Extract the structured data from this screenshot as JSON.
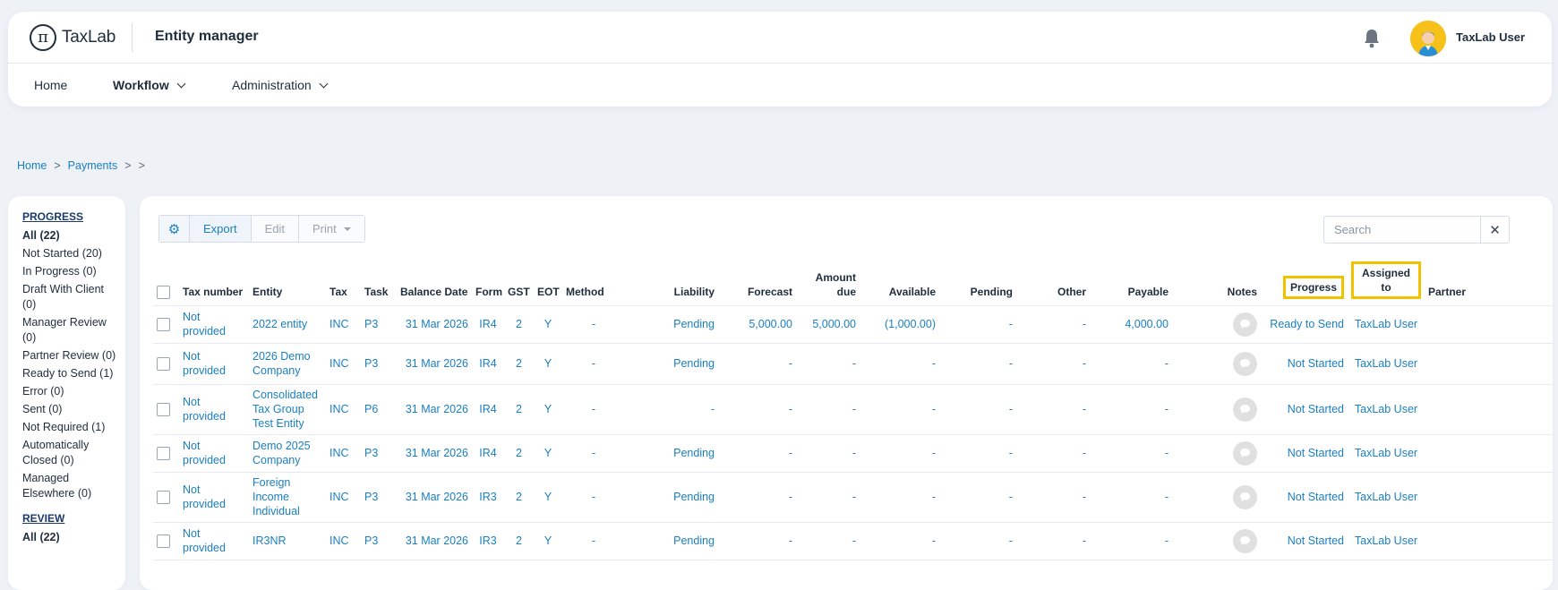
{
  "header": {
    "logo_text": "TaxLab",
    "app_title": "Entity manager",
    "user_name": "TaxLab User"
  },
  "nav": {
    "items": [
      {
        "label": "Home"
      },
      {
        "label": "Workflow"
      },
      {
        "label": "Administration"
      }
    ]
  },
  "breadcrumb": {
    "items": [
      "Home",
      "Payments"
    ],
    "separator": ">"
  },
  "sidebar": {
    "progress_heading": "PROGRESS",
    "progress_items": [
      "All (22)",
      "Not Started (20)",
      "In Progress (0)",
      "Draft With Client (0)",
      "Manager Review (0)",
      "Partner Review (0)",
      "Ready to Send (1)",
      "Error (0)",
      "Sent (0)",
      "Not Required (1)",
      "Automatically Closed (0)",
      "Managed Elsewhere (0)"
    ],
    "review_heading": "REVIEW",
    "review_items": [
      "All (22)"
    ]
  },
  "toolbar": {
    "export_label": "Export",
    "edit_label": "Edit",
    "print_label": "Print",
    "search_placeholder": "Search",
    "clear_label": "✕"
  },
  "table": {
    "headers": {
      "tax_number": "Tax number",
      "entity": "Entity",
      "tax": "Tax",
      "task": "Task",
      "balance_date": "Balance Date",
      "form": "Form",
      "gst": "GST",
      "eot": "EOT",
      "method": "Method",
      "liability": "Liability",
      "forecast": "Forecast",
      "amount_due": "Amount due",
      "available": "Available",
      "pending": "Pending",
      "other": "Other",
      "payable": "Payable",
      "notes": "Notes",
      "progress": "Progress",
      "assigned_to": "Assigned to",
      "partner": "Partner"
    },
    "rows": [
      {
        "tax_number": "Not provided",
        "entity": "2022 entity",
        "tax": "INC",
        "task": "P3",
        "balance_date": "31 Mar 2026",
        "form": "IR4",
        "gst": "2",
        "eot": "Y",
        "method": "-",
        "liability": "Pending",
        "forecast": "5,000.00",
        "amount_due": "5,000.00",
        "available": "(1,000.00)",
        "pending": "-",
        "other": "-",
        "payable": "4,000.00",
        "progress": "Ready to Send",
        "assigned_to": "TaxLab User",
        "partner": ""
      },
      {
        "tax_number": "Not provided",
        "entity": "2026 Demo Company",
        "tax": "INC",
        "task": "P3",
        "balance_date": "31 Mar 2026",
        "form": "IR4",
        "gst": "2",
        "eot": "Y",
        "method": "-",
        "liability": "Pending",
        "forecast": "-",
        "amount_due": "-",
        "available": "-",
        "pending": "-",
        "other": "-",
        "payable": "-",
        "progress": "Not Started",
        "assigned_to": "TaxLab User",
        "partner": ""
      },
      {
        "tax_number": "Not provided",
        "entity": "Consolidated Tax Group Test Entity",
        "tax": "INC",
        "task": "P6",
        "balance_date": "31 Mar 2026",
        "form": "IR4",
        "gst": "2",
        "eot": "Y",
        "method": "-",
        "liability": "-",
        "forecast": "-",
        "amount_due": "-",
        "available": "-",
        "pending": "-",
        "other": "-",
        "payable": "-",
        "progress": "Not Started",
        "assigned_to": "TaxLab User",
        "partner": ""
      },
      {
        "tax_number": "Not provided",
        "entity": "Demo 2025 Company",
        "tax": "INC",
        "task": "P3",
        "balance_date": "31 Mar 2026",
        "form": "IR4",
        "gst": "2",
        "eot": "Y",
        "method": "-",
        "liability": "Pending",
        "forecast": "-",
        "amount_due": "-",
        "available": "-",
        "pending": "-",
        "other": "-",
        "payable": "-",
        "progress": "Not Started",
        "assigned_to": "TaxLab User",
        "partner": ""
      },
      {
        "tax_number": "Not provided",
        "entity": "Foreign Income Individual",
        "tax": "INC",
        "task": "P3",
        "balance_date": "31 Mar 2026",
        "form": "IR3",
        "gst": "2",
        "eot": "Y",
        "method": "-",
        "liability": "Pending",
        "forecast": "-",
        "amount_due": "-",
        "available": "-",
        "pending": "-",
        "other": "-",
        "payable": "-",
        "progress": "Not Started",
        "assigned_to": "TaxLab User",
        "partner": ""
      },
      {
        "tax_number": "Not provided",
        "entity": "IR3NR",
        "tax": "INC",
        "task": "P3",
        "balance_date": "31 Mar 2026",
        "form": "IR3",
        "gst": "2",
        "eot": "Y",
        "method": "-",
        "liability": "Pending",
        "forecast": "-",
        "amount_due": "-",
        "available": "-",
        "pending": "-",
        "other": "-",
        "payable": "-",
        "progress": "Not Started",
        "assigned_to": "TaxLab User",
        "partner": ""
      }
    ]
  }
}
